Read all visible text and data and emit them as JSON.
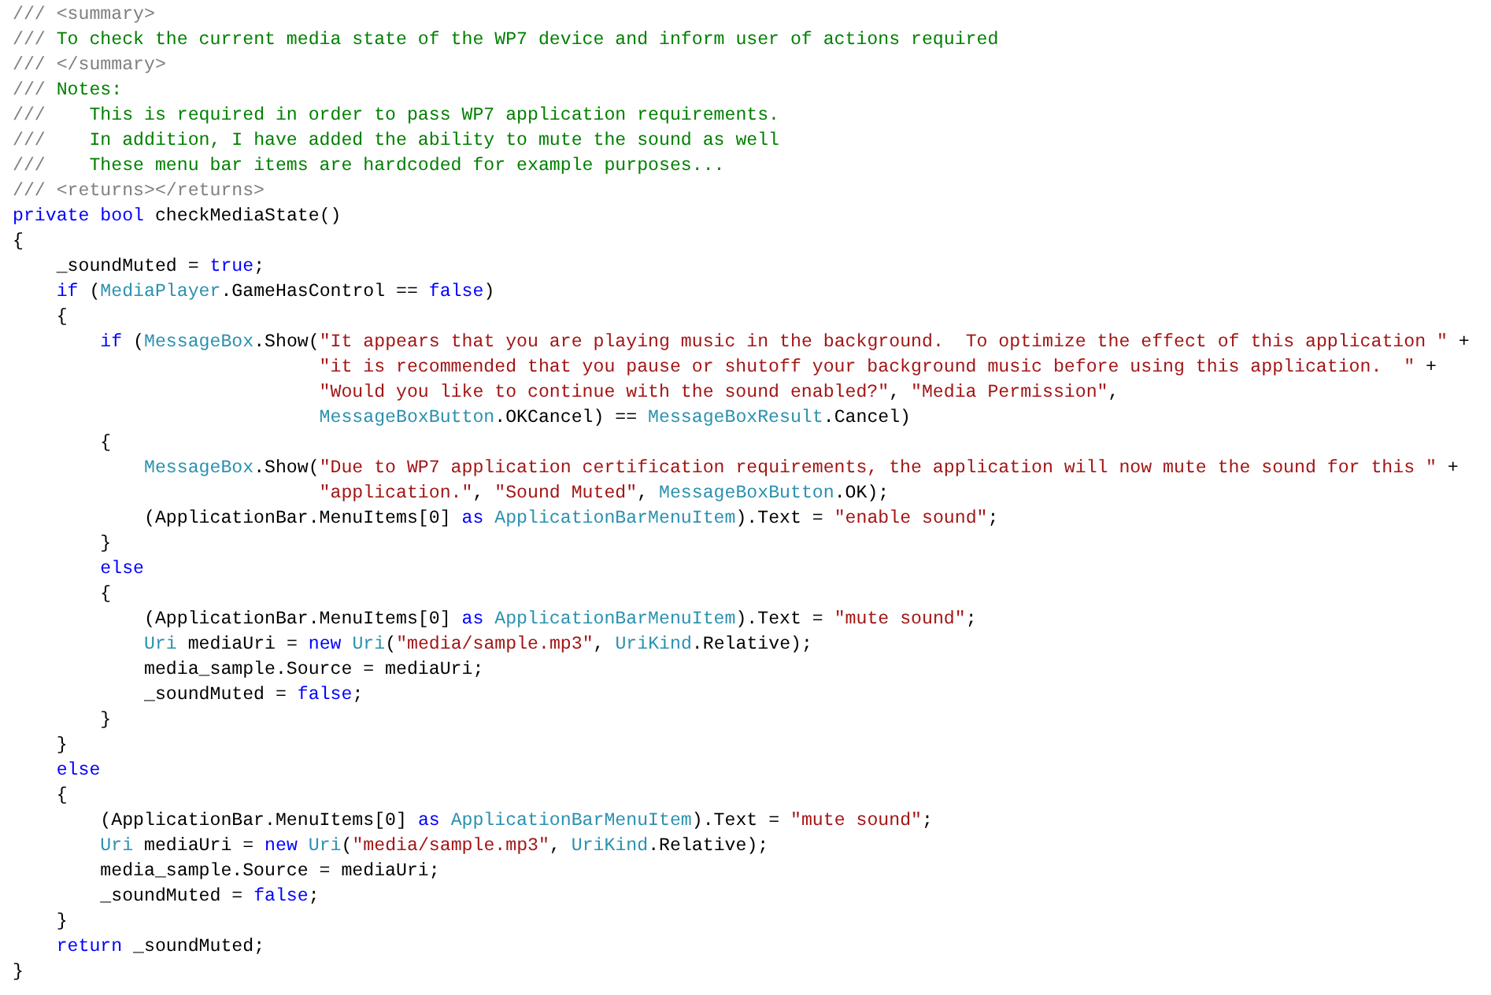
{
  "editor": {
    "lines": [
      {
        "tokens": [
          {
            "kind": "doc",
            "text": "/// <summary>"
          }
        ]
      },
      {
        "tokens": [
          {
            "kind": "doc",
            "text": "///"
          },
          {
            "kind": "comment",
            "text": " To check the current media state of the WP7 device and inform user of actions required"
          }
        ]
      },
      {
        "tokens": [
          {
            "kind": "doc",
            "text": "/// </summary>"
          }
        ]
      },
      {
        "tokens": [
          {
            "kind": "doc",
            "text": "///"
          },
          {
            "kind": "comment",
            "text": " Notes:"
          }
        ]
      },
      {
        "tokens": [
          {
            "kind": "doc",
            "text": "///"
          },
          {
            "kind": "comment",
            "text": "    This is required in order to pass WP7 application requirements."
          }
        ]
      },
      {
        "tokens": [
          {
            "kind": "doc",
            "text": "///"
          },
          {
            "kind": "comment",
            "text": "    In addition, I have added the ability to mute the sound as well"
          }
        ]
      },
      {
        "tokens": [
          {
            "kind": "doc",
            "text": "///"
          },
          {
            "kind": "comment",
            "text": "    These menu bar items are hardcoded for example purposes..."
          }
        ]
      },
      {
        "tokens": [
          {
            "kind": "doc",
            "text": "/// <returns></returns>"
          }
        ]
      },
      {
        "tokens": [
          {
            "kind": "keyword",
            "text": "private bool"
          },
          {
            "kind": "plain",
            "text": " checkMediaState()"
          }
        ]
      },
      {
        "tokens": [
          {
            "kind": "plain",
            "text": "{"
          }
        ]
      },
      {
        "tokens": [
          {
            "kind": "plain",
            "text": "    _soundMuted = "
          },
          {
            "kind": "keyword",
            "text": "true"
          },
          {
            "kind": "plain",
            "text": ";"
          }
        ]
      },
      {
        "tokens": [
          {
            "kind": "keyword",
            "text": "    if"
          },
          {
            "kind": "plain",
            "text": " ("
          },
          {
            "kind": "type",
            "text": "MediaPlayer"
          },
          {
            "kind": "plain",
            "text": ".GameHasControl == "
          },
          {
            "kind": "keyword",
            "text": "false"
          },
          {
            "kind": "plain",
            "text": ")"
          }
        ]
      },
      {
        "tokens": [
          {
            "kind": "plain",
            "text": "    {"
          }
        ]
      },
      {
        "tokens": [
          {
            "kind": "keyword",
            "text": "        if"
          },
          {
            "kind": "plain",
            "text": " ("
          },
          {
            "kind": "type",
            "text": "MessageBox"
          },
          {
            "kind": "plain",
            "text": ".Show("
          },
          {
            "kind": "string",
            "text": "\"It appears that you are playing music in the background.  To optimize the effect of this application \""
          },
          {
            "kind": "plain",
            "text": " +"
          }
        ]
      },
      {
        "tokens": [
          {
            "kind": "string",
            "text": "                            \"it is recommended that you pause or shutoff your background music before using this application.  \""
          },
          {
            "kind": "plain",
            "text": " +"
          }
        ]
      },
      {
        "tokens": [
          {
            "kind": "string",
            "text": "                            \"Would you like to continue with the sound enabled?\""
          },
          {
            "kind": "plain",
            "text": ", "
          },
          {
            "kind": "string",
            "text": "\"Media Permission\""
          },
          {
            "kind": "plain",
            "text": ","
          }
        ]
      },
      {
        "tokens": [
          {
            "kind": "type",
            "text": "                            MessageBoxButton"
          },
          {
            "kind": "plain",
            "text": ".OKCancel) == "
          },
          {
            "kind": "type",
            "text": "MessageBoxResult"
          },
          {
            "kind": "plain",
            "text": ".Cancel)"
          }
        ]
      },
      {
        "tokens": [
          {
            "kind": "plain",
            "text": "        {"
          }
        ]
      },
      {
        "tokens": [
          {
            "kind": "type",
            "text": "            MessageBox"
          },
          {
            "kind": "plain",
            "text": ".Show("
          },
          {
            "kind": "string",
            "text": "\"Due to WP7 application certification requirements, the application will now mute the sound for this \""
          },
          {
            "kind": "plain",
            "text": " +"
          }
        ]
      },
      {
        "tokens": [
          {
            "kind": "string",
            "text": "                            \"application.\""
          },
          {
            "kind": "plain",
            "text": ", "
          },
          {
            "kind": "string",
            "text": "\"Sound Muted\""
          },
          {
            "kind": "plain",
            "text": ", "
          },
          {
            "kind": "type",
            "text": "MessageBoxButton"
          },
          {
            "kind": "plain",
            "text": ".OK);"
          }
        ]
      },
      {
        "tokens": [
          {
            "kind": "plain",
            "text": "            (ApplicationBar.MenuItems[0] "
          },
          {
            "kind": "keyword",
            "text": "as "
          },
          {
            "kind": "type",
            "text": "ApplicationBarMenuItem"
          },
          {
            "kind": "plain",
            "text": ").Text = "
          },
          {
            "kind": "string",
            "text": "\"enable sound\""
          },
          {
            "kind": "plain",
            "text": ";"
          }
        ]
      },
      {
        "tokens": [
          {
            "kind": "plain",
            "text": "        }"
          }
        ]
      },
      {
        "tokens": [
          {
            "kind": "keyword",
            "text": "        else"
          }
        ]
      },
      {
        "tokens": [
          {
            "kind": "plain",
            "text": "        {"
          }
        ]
      },
      {
        "tokens": [
          {
            "kind": "plain",
            "text": "            (ApplicationBar.MenuItems[0] "
          },
          {
            "kind": "keyword",
            "text": "as "
          },
          {
            "kind": "type",
            "text": "ApplicationBarMenuItem"
          },
          {
            "kind": "plain",
            "text": ").Text = "
          },
          {
            "kind": "string",
            "text": "\"mute sound\""
          },
          {
            "kind": "plain",
            "text": ";"
          }
        ]
      },
      {
        "tokens": [
          {
            "kind": "type",
            "text": "            Uri"
          },
          {
            "kind": "plain",
            "text": " mediaUri = "
          },
          {
            "kind": "keyword",
            "text": "new "
          },
          {
            "kind": "type",
            "text": "Uri"
          },
          {
            "kind": "plain",
            "text": "("
          },
          {
            "kind": "string",
            "text": "\"media/sample.mp3\""
          },
          {
            "kind": "plain",
            "text": ", "
          },
          {
            "kind": "type",
            "text": "UriKind"
          },
          {
            "kind": "plain",
            "text": ".Relative);"
          }
        ]
      },
      {
        "tokens": [
          {
            "kind": "plain",
            "text": "            media_sample.Source = mediaUri;"
          }
        ]
      },
      {
        "tokens": [
          {
            "kind": "plain",
            "text": "            _soundMuted = "
          },
          {
            "kind": "keyword",
            "text": "false"
          },
          {
            "kind": "plain",
            "text": ";"
          }
        ]
      },
      {
        "tokens": [
          {
            "kind": "plain",
            "text": "        }"
          }
        ]
      },
      {
        "tokens": [
          {
            "kind": "plain",
            "text": "    }"
          }
        ]
      },
      {
        "tokens": [
          {
            "kind": "keyword",
            "text": "    else"
          }
        ]
      },
      {
        "tokens": [
          {
            "kind": "plain",
            "text": "    {"
          }
        ]
      },
      {
        "tokens": [
          {
            "kind": "plain",
            "text": "        (ApplicationBar.MenuItems[0] "
          },
          {
            "kind": "keyword",
            "text": "as "
          },
          {
            "kind": "type",
            "text": "ApplicationBarMenuItem"
          },
          {
            "kind": "plain",
            "text": ").Text = "
          },
          {
            "kind": "string",
            "text": "\"mute sound\""
          },
          {
            "kind": "plain",
            "text": ";"
          }
        ]
      },
      {
        "tokens": [
          {
            "kind": "type",
            "text": "        Uri"
          },
          {
            "kind": "plain",
            "text": " mediaUri = "
          },
          {
            "kind": "keyword",
            "text": "new "
          },
          {
            "kind": "type",
            "text": "Uri"
          },
          {
            "kind": "plain",
            "text": "("
          },
          {
            "kind": "string",
            "text": "\"media/sample.mp3\""
          },
          {
            "kind": "plain",
            "text": ", "
          },
          {
            "kind": "type",
            "text": "UriKind"
          },
          {
            "kind": "plain",
            "text": ".Relative);"
          }
        ]
      },
      {
        "tokens": [
          {
            "kind": "plain",
            "text": "        media_sample.Source = mediaUri;"
          }
        ]
      },
      {
        "tokens": [
          {
            "kind": "plain",
            "text": "        _soundMuted = "
          },
          {
            "kind": "keyword",
            "text": "false"
          },
          {
            "kind": "plain",
            "text": ";"
          }
        ]
      },
      {
        "tokens": [
          {
            "kind": "plain",
            "text": "    }"
          }
        ]
      },
      {
        "tokens": [
          {
            "kind": "keyword",
            "text": "    return"
          },
          {
            "kind": "plain",
            "text": " _soundMuted;"
          }
        ]
      },
      {
        "tokens": [
          {
            "kind": "plain",
            "text": "}"
          }
        ]
      }
    ]
  }
}
